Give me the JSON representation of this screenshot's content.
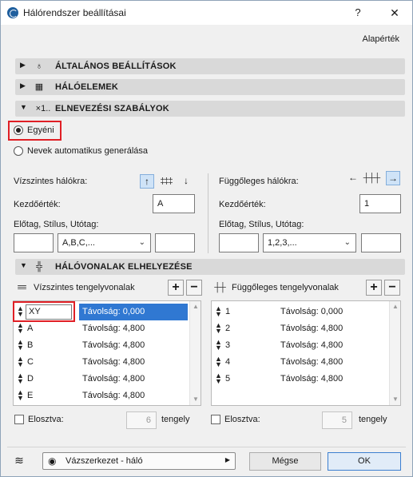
{
  "window": {
    "title": "Hálórendszer beállításai",
    "help_label": "?",
    "close_label": "✕"
  },
  "defaults_label": "Alapérték",
  "sections": {
    "general": {
      "title": "ÁLTALÁNOS BEÁLLÍTÁSOK",
      "icon": "pin-icon",
      "expanded": false
    },
    "elements": {
      "title": "HÁLÓELEMEK",
      "icon": "grid-elements-icon",
      "expanded": false
    },
    "naming": {
      "title": "ELNEVEZÉSI SZABÁLYOK",
      "icon": "naming-icon",
      "icon_text": "×1..",
      "expanded": true
    },
    "placement": {
      "title": "HÁLÓVONALAK ELHELYEZÉSE",
      "icon": "grid-placement-icon",
      "expanded": true
    }
  },
  "naming": {
    "option_custom": "Egyéni",
    "option_auto": "Nevek automatikus generálása",
    "selected": "custom",
    "horizontal": {
      "label": "Vízszintes hálókra:",
      "start_label": "Kezdőérték:",
      "start_value": "A",
      "format_label": "Előtag, Stílus, Utótag:",
      "prefix": "",
      "style": "A,B,C,...",
      "suffix": ""
    },
    "vertical": {
      "label": "Függőleges hálókra:",
      "start_label": "Kezdőérték:",
      "start_value": "1",
      "format_label": "Előtag, Stílus, Utótag:",
      "prefix": "",
      "style": "1,2,3,...",
      "suffix": ""
    }
  },
  "placement": {
    "horizontal": {
      "title": "Vízszintes tengelyvonalak",
      "add": "+",
      "remove": "−",
      "rows": [
        {
          "name": "XY",
          "distance": "Távolság: 0,000",
          "selected": true
        },
        {
          "name": "A",
          "distance": "Távolság: 4,800"
        },
        {
          "name": "B",
          "distance": "Távolság: 4,800"
        },
        {
          "name": "C",
          "distance": "Távolság: 4,800"
        },
        {
          "name": "D",
          "distance": "Távolság: 4,800"
        },
        {
          "name": "E",
          "distance": "Távolság: 4,800"
        }
      ],
      "distribute_label": "Elosztva:",
      "distribute_value": "6",
      "axis_label": "tengely"
    },
    "vertical": {
      "title": "Függőleges tengelyvonalak",
      "add": "+",
      "remove": "−",
      "rows": [
        {
          "name": "1",
          "distance": "Távolság: 0,000"
        },
        {
          "name": "2",
          "distance": "Távolság: 4,800"
        },
        {
          "name": "3",
          "distance": "Távolság: 4,800"
        },
        {
          "name": "4",
          "distance": "Távolság: 4,800"
        },
        {
          "name": "5",
          "distance": "Távolság: 4,800"
        }
      ],
      "distribute_label": "Elosztva:",
      "distribute_value": "5",
      "axis_label": "tengely"
    }
  },
  "footer": {
    "view": "Vázszerkezet - háló",
    "cancel": "Mégse",
    "ok": "OK"
  },
  "colors": {
    "selection": "#3078d2",
    "highlight": "#e01f25",
    "section_header": "#d9d9d9"
  }
}
